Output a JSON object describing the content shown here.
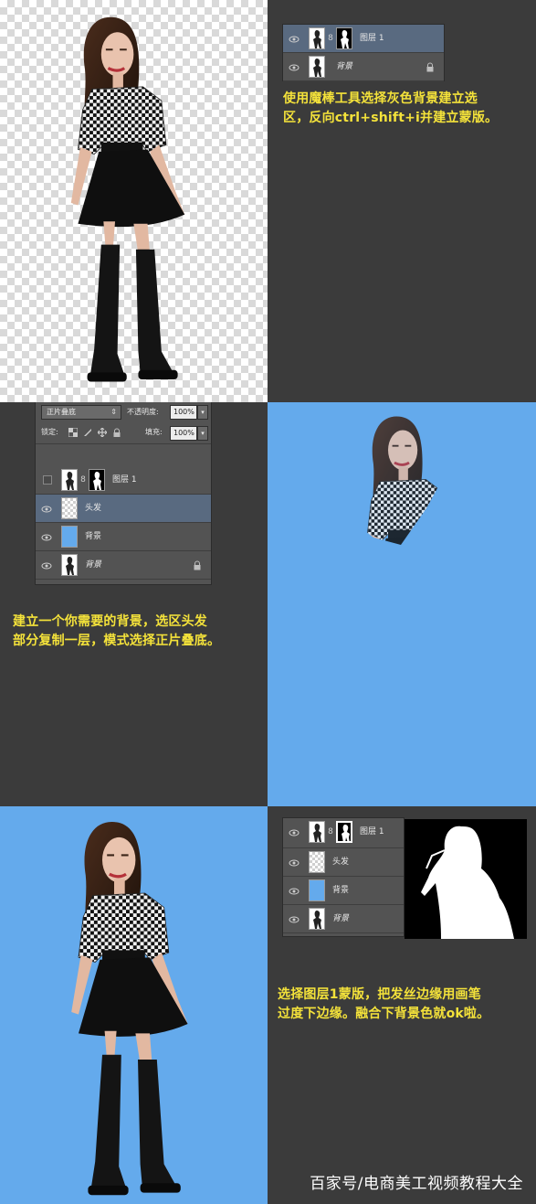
{
  "step1": {
    "layers": [
      {
        "name": "图层 1",
        "selected": true,
        "has_mask": true
      },
      {
        "name": "背景",
        "italic": true,
        "locked": true
      }
    ],
    "caption_lines": [
      "使用魔棒工具选择灰色背景建立选",
      "区，反向ctrl+shift+i并建立蒙版。"
    ]
  },
  "step2": {
    "blend_mode": "正片叠底",
    "opacity_label": "不透明度:",
    "opacity_value": "100%",
    "lock_label": "锁定:",
    "fill_label": "填充:",
    "fill_value": "100%",
    "layers": [
      {
        "name": "图层 1",
        "visible": false,
        "has_mask": true
      },
      {
        "name": "头发",
        "selected": true
      },
      {
        "name": "背景"
      },
      {
        "name": "背景",
        "italic": true,
        "locked": true
      }
    ],
    "caption_lines": [
      "建立一个你需要的背景，选区头发",
      "部分复制一层，模式选择正片叠底。"
    ]
  },
  "step3": {
    "layers": [
      {
        "name": "图层 1",
        "has_mask": true
      },
      {
        "name": "头发"
      },
      {
        "name": "背景"
      },
      {
        "name": "背景",
        "italic": true
      }
    ],
    "caption_lines": [
      "选择图层1蒙版，把发丝边缘用画笔",
      "过度下边缘。融合下背景色就ok啦。"
    ]
  },
  "watermark": "百家号/电商美工视频教程大全",
  "colors": {
    "dark_bg": "#3b3b3b",
    "blue_bg": "#64aaec",
    "caption": "#f4e23a",
    "panel": "#535353",
    "selected_layer": "#596a80"
  }
}
